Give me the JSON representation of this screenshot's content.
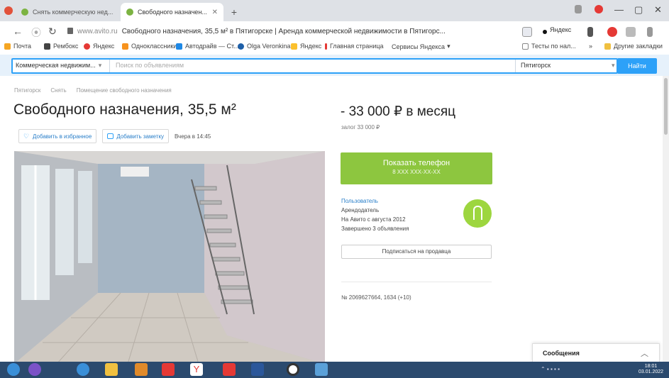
{
  "browser": {
    "tabs": [
      {
        "title": "Снять коммерческую нед...",
        "active": false
      },
      {
        "title": "Свободного назначен...",
        "active": true
      }
    ],
    "new_tab": "+",
    "window_controls": {
      "minimize": "—",
      "maximize": "▢",
      "close": "✕"
    }
  },
  "address_bar": {
    "back": "←",
    "forward": "→",
    "reload": "↻",
    "host": "www.avito.ru",
    "page_title": "Свободного назначения, 35,5 м² в Пятигорске | Аренда коммерческой недвижимости в Пятигорс...",
    "profile_label": "Яндекс"
  },
  "bookmarks": [
    "Почта",
    "Рембокс",
    "Яндекс",
    "Одноклассники",
    "Автодрайв — Ст...",
    "Olga Veronkina",
    "Яндекс",
    "Главная страница",
    "Сервисы Яндекса",
    "Тесты по нал...",
    "Другие закладки"
  ],
  "search": {
    "category": "Коммерческая недвижим...",
    "placeholder": "Поиск по объявлениям",
    "city": "Пятигорск",
    "button": "Найти"
  },
  "breadcrumb": [
    "Пятигорск",
    "Снять",
    "Помещение свободного назначения"
  ],
  "listing": {
    "title": "Свободного назначения, 35,5 м²",
    "price": "33 000 ₽ в месяц",
    "deposit": "залог 33 000 ₽",
    "favorite_label": "Добавить в избранное",
    "note_label": "Добавить заметку",
    "posted": "Вчера в 14:45"
  },
  "seller": {
    "phone_label": "Показать телефон",
    "phone_masked": "8 XXX XXX-XX-XX",
    "name": "Пользователь",
    "role": "Арендодатель",
    "since": "На Авито с августа 2012",
    "completed": "Завершено 3 объявления",
    "subscribe_label": "Подписаться на продавца"
  },
  "ad_meta": "№ 2069627664, 1634 (+10)",
  "messages": {
    "label": "Сообщения"
  },
  "taskbar": {
    "time": "18:01",
    "date": "03.01.2022"
  },
  "colors": {
    "accent_blue": "#2da1f8",
    "phone_green": "#8dc63f",
    "avatar_green": "#9dd63f",
    "taskbar": "#2b4a6e"
  }
}
